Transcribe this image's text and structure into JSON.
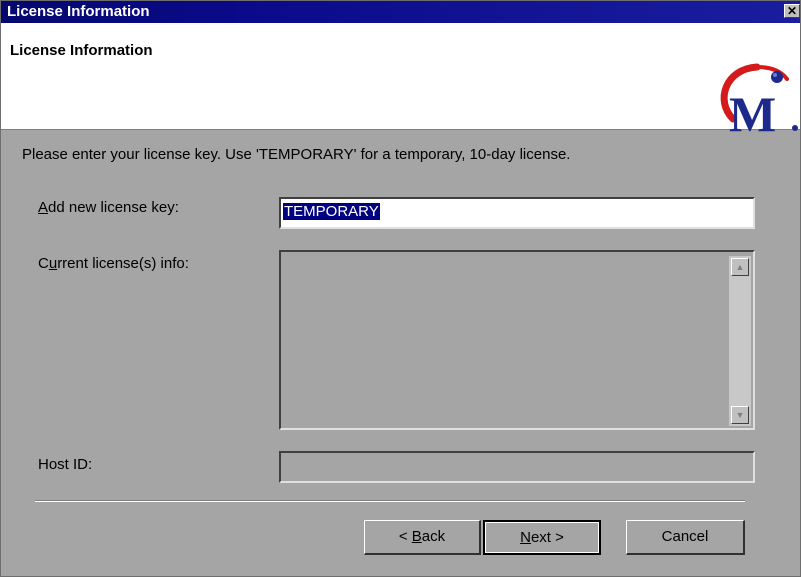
{
  "window": {
    "title": "License Information",
    "close_glyph": "✕"
  },
  "header": {
    "title": "License Information",
    "logo_icon": "mercury-logo"
  },
  "instruction": "Please enter your license key. Use 'TEMPORARY' for a temporary, 10-day license.",
  "form": {
    "license_key_label_prefix": "A",
    "license_key_label_rest": "dd new license key:",
    "license_key_value": "TEMPORARY",
    "current_info_label_prefix": "C",
    "current_info_label_u": "u",
    "current_info_label_rest": "rrent license(s) info:",
    "current_info_value": "",
    "host_id_label": "Host ID:",
    "host_id_value": ""
  },
  "scrollbar": {
    "up_glyph": "▲",
    "down_glyph": "▼"
  },
  "buttons": {
    "back_prefix": "< ",
    "back_u": "B",
    "back_rest": "ack",
    "next_u": "N",
    "next_rest": "ext >",
    "cancel": "Cancel"
  },
  "colors": {
    "title_bar": "#0a0a8a",
    "selection": "#000080",
    "dialog_bg": "#a5a5a5",
    "logo_red": "#d41a1a",
    "logo_blue": "#1c2a8c"
  }
}
